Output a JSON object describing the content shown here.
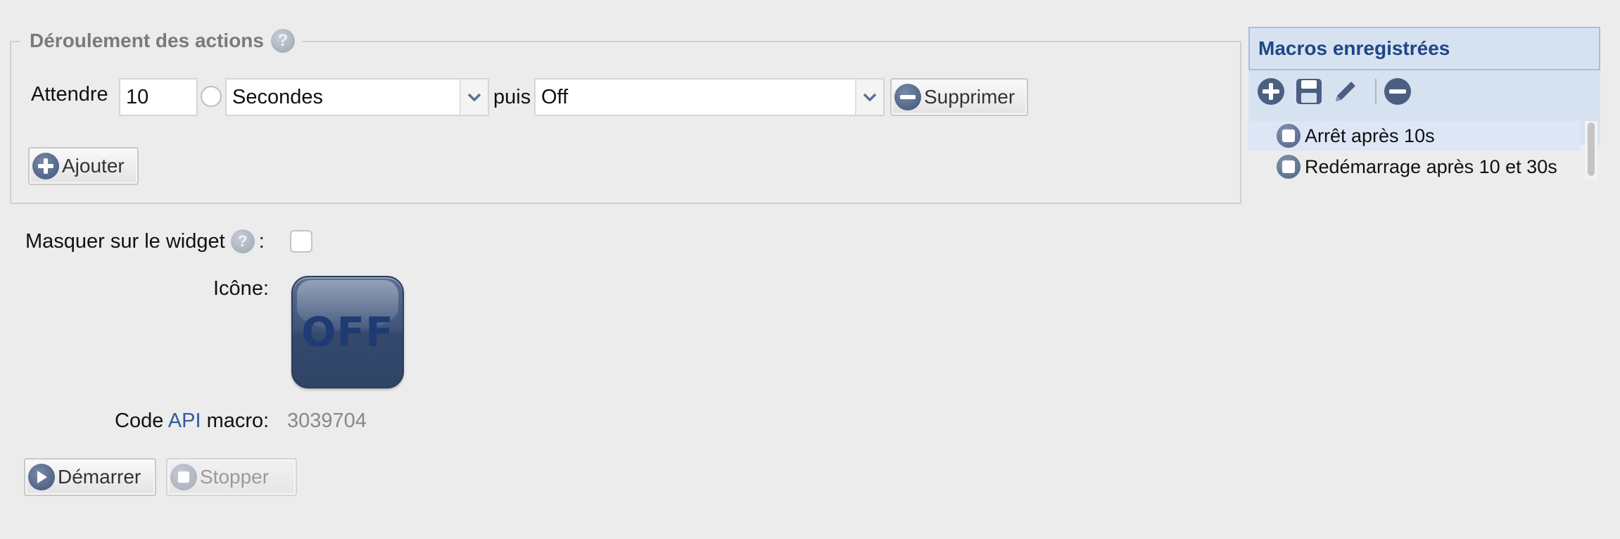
{
  "actions": {
    "legend": "Déroulement des actions",
    "help": "?",
    "wait_label": "Attendre",
    "wait_value": "10",
    "unit_selected": "Secondes",
    "then_label": "puis",
    "action_selected": "Off",
    "delete_label": "Supprimer",
    "add_label": "Ajouter"
  },
  "form": {
    "hide_label": "Masquer sur le widget",
    "hide_colon": ":",
    "hide_checked": false,
    "icon_label": "Icône:",
    "icon_text": "OFF",
    "api_prefix": "Code ",
    "api_link": "API",
    "api_suffix": " macro:",
    "api_value": "3039704",
    "start_label": "Démarrer",
    "stop_label": "Stopper"
  },
  "macros": {
    "title": "Macros enregistrées",
    "toolbar": [
      "plus-icon",
      "save-icon",
      "pencil-icon",
      "minus-icon"
    ],
    "items": [
      {
        "label": "Arrêt après 10s",
        "selected": true
      },
      {
        "label": "Redémarrage après 10 et 30s",
        "selected": false
      }
    ]
  },
  "colors": {
    "accent": "#1f4688",
    "panel_bg": "#d7e2f1",
    "icon_blue": "#3f5479",
    "page_bg": "#ececec"
  }
}
